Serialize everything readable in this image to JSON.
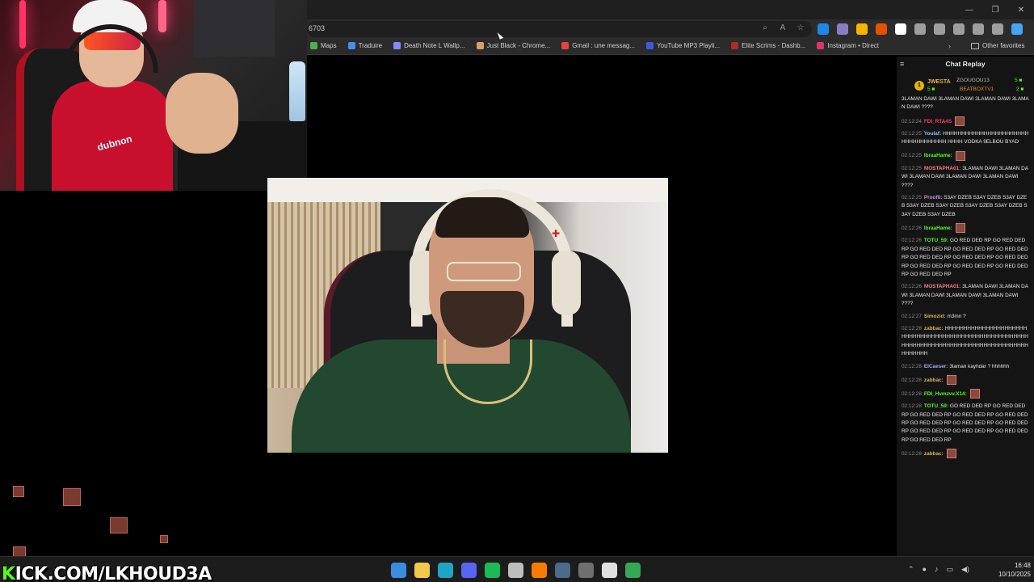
{
  "browser": {
    "url": "6703",
    "bookmarks": [
      {
        "label": "Maps",
        "color": "#4caf50"
      },
      {
        "label": "Traduire",
        "color": "#4a8af4"
      },
      {
        "label": "Death Note L Wallp...",
        "color": "#7f8cff"
      },
      {
        "label": "Just Black - Chrome...",
        "color": "#d9a066"
      },
      {
        "label": "Gmail : une messag...",
        "color": "#ea4335"
      },
      {
        "label": "YouTube MP3 Playli...",
        "color": "#3b5bdb"
      },
      {
        "label": "Elite Scrims - Dashb...",
        "color": "#b02a2a"
      },
      {
        "label": "Instagram • Direct",
        "color": "#e1306c"
      }
    ],
    "other_favorites": "Other favorites",
    "extension_colors": [
      "#1e88e5",
      "#8e7cc3",
      "#f4b400",
      "#e65100",
      "#ffffff",
      "#9e9e9e",
      "#9e9e9e",
      "#9e9e9e",
      "#9e9e9e",
      "#9e9e9e",
      "#42a5f5"
    ]
  },
  "chat": {
    "title": "Chat Replay",
    "gifters": {
      "badge": "1",
      "top_name": "JWESTA",
      "top_count": "5 ■",
      "second_name": "ZGOUGOU13",
      "second_count": "5 ■",
      "third_name": "BEATBOXTV1",
      "third_count": "2 ■"
    },
    "messages": [
      {
        "ts": "",
        "user": "",
        "user_color": "#ffffff",
        "text": "3LAMAN DAWI 3LAMAN DAWI 3LAMAN DAWI 3LAMAN DAWI ????",
        "emote": false
      },
      {
        "ts": "02:12:24",
        "user": "FDI_RTA4S",
        "user_color": "#ff3b6b",
        "text": "",
        "emote": true
      },
      {
        "ts": "02:12:25",
        "user": "Youlaf:",
        "user_color": "#7ec8ff",
        "text": "HHHHHHHHHHHHHHHHHHHHHHHHHHHHHHHHHHH HHHH VODKA 9ELBOU BYAD",
        "emote": false
      },
      {
        "ts": "02:12:25",
        "user": "IbraaHame:",
        "user_color": "#53fc18",
        "text": "",
        "emote": true
      },
      {
        "ts": "02:12:25",
        "user": "MOSTAPHA01:",
        "user_color": "#ff7b7b",
        "text": "3LAMAN DAWI 3LAMAN DAWI 3LAMAN DAWI 3LAMAN DAWI 3LAMAN DAWI ????",
        "emote": false
      },
      {
        "ts": "02:12:25",
        "user": "Proof0:",
        "user_color": "#c792ea",
        "text": "S3AY DZEB S3AY DZEB S3AY DZEB S3AY DZEB S3AY DZEB S3AY DZEB S3AY DZEB S3AY DZEB S3AY DZEB",
        "emote": false
      },
      {
        "ts": "02:12:26",
        "user": "IbraaHame:",
        "user_color": "#53fc18",
        "text": "",
        "emote": true
      },
      {
        "ts": "02:12:26",
        "user": "TOTU_59:",
        "user_color": "#53fc18",
        "text": "GO RED DED RP GO RED DED RP GO RED DED RP GO RED DED RP GO RED DED RP GO RED DED RP GO RED DED RP GO RED DED RP GO RED DED RP GO RED DED RP GO RED DED RP GO RED DED RP",
        "emote": false
      },
      {
        "ts": "02:12:26",
        "user": "MOSTAPHA01:",
        "user_color": "#ff7b7b",
        "text": "3LAMAN DAWI 3LAMAN DAWI 3LAMAN DAWI 3LAMAN DAWI 3LAMAN DAWI ????",
        "emote": false
      },
      {
        "ts": "02:12:27",
        "user": "Simozid:",
        "user_color": "#e3b341",
        "text": "m3mn ?",
        "emote": false
      },
      {
        "ts": "02:12:28",
        "user": "zabbac:",
        "user_color": "#e3b341",
        "text": "HHHHHHHHHHHHHHHHHHHHHHHHHHHHHHHHHHHHHHHHHHHHHHHHHHHHHHHHHHHHHHHHHHHHHHHHHHHHHHHHHHHHHHHHHHHHHHHHH",
        "emote": false
      },
      {
        "ts": "02:12:28",
        "user": "ElCaeser:",
        "user_color": "#a5a5ff",
        "text": "3laman kayhdar ? hhhhhh",
        "emote": false
      },
      {
        "ts": "02:12:28",
        "user": "zabbac:",
        "user_color": "#e3b341",
        "text": "",
        "emote": true
      },
      {
        "ts": "02:12:28",
        "user": "FDI_Hvmzvv.X14:",
        "user_color": "#53fc18",
        "text": "",
        "emote": true
      },
      {
        "ts": "02:12:28",
        "user": "TOTU_59:",
        "user_color": "#53fc18",
        "text": "GO RED DED RP GO RED DED RP GO RED DED RP GO RED DED RP GO RED DED RP GO RED DED RP GO RED DED RP GO RED DED RP GO RED DED RP GO RED DED RP GO RED DED RP GO RED DED RP",
        "emote": false
      },
      {
        "ts": "02:12:28",
        "user": "zabbac:",
        "user_color": "#e3b341",
        "text": "",
        "emote": true
      }
    ]
  },
  "overlay": {
    "kick_prefix": "K",
    "kick_rest": "ICK.COM/LKHOUD3A",
    "shirt_text": "dubnon"
  },
  "taskbar": {
    "icons": [
      {
        "name": "start-icon",
        "color": "#3a8dde"
      },
      {
        "name": "file-explorer-icon",
        "color": "#f2c94c"
      },
      {
        "name": "edge-icon",
        "color": "#1fa3c7"
      },
      {
        "name": "discord-icon",
        "color": "#5865f2"
      },
      {
        "name": "spotify-icon",
        "color": "#1db954"
      },
      {
        "name": "store-icon",
        "color": "#bdbdbd"
      },
      {
        "name": "app-orange-icon",
        "color": "#f57c00"
      },
      {
        "name": "steam-icon",
        "color": "#4a6b8a"
      },
      {
        "name": "obs-icon",
        "color": "#6f6f6f"
      },
      {
        "name": "github-icon",
        "color": "#e0e0e0"
      },
      {
        "name": "chrome-icon",
        "color": "#34a853"
      }
    ],
    "time": "16:48",
    "date": "10/10/2025"
  }
}
